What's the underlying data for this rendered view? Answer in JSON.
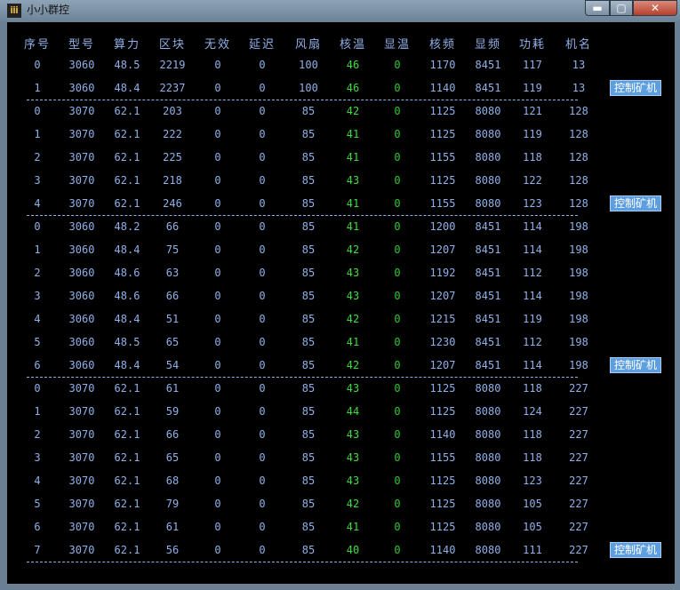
{
  "window": {
    "title": "小小群控",
    "icon": "app-logo-icon",
    "controls": {
      "minimize": "▬",
      "maximize": "▢",
      "close": "✕"
    }
  },
  "colors": {
    "background": "#000000",
    "text": "#8fb0e8",
    "core_temp": "#3ddc3d",
    "button": "#5d9ee0"
  },
  "table": {
    "columns": [
      "序号",
      "型号",
      "算力",
      "区块",
      "无效",
      "延迟",
      "风扇",
      "核温",
      "显温",
      "核频",
      "显频",
      "功耗",
      "机名"
    ],
    "groups": [
      {
        "button_label": "控制矿机",
        "rows": [
          [
            "0",
            "3060",
            "48.5",
            "2219",
            "0",
            "0",
            "100",
            "46",
            "0",
            "1170",
            "8451",
            "117",
            "13"
          ],
          [
            "1",
            "3060",
            "48.4",
            "2237",
            "0",
            "0",
            "100",
            "46",
            "0",
            "1140",
            "8451",
            "119",
            "13"
          ]
        ]
      },
      {
        "button_label": "控制矿机",
        "rows": [
          [
            "0",
            "3070",
            "62.1",
            "203",
            "0",
            "0",
            "85",
            "42",
            "0",
            "1125",
            "8080",
            "121",
            "128"
          ],
          [
            "1",
            "3070",
            "62.1",
            "222",
            "0",
            "0",
            "85",
            "41",
            "0",
            "1125",
            "8080",
            "119",
            "128"
          ],
          [
            "2",
            "3070",
            "62.1",
            "225",
            "0",
            "0",
            "85",
            "41",
            "0",
            "1155",
            "8080",
            "118",
            "128"
          ],
          [
            "3",
            "3070",
            "62.1",
            "218",
            "0",
            "0",
            "85",
            "43",
            "0",
            "1125",
            "8080",
            "122",
            "128"
          ],
          [
            "4",
            "3070",
            "62.1",
            "246",
            "0",
            "0",
            "85",
            "41",
            "0",
            "1155",
            "8080",
            "123",
            "128"
          ]
        ]
      },
      {
        "button_label": "控制矿机",
        "rows": [
          [
            "0",
            "3060",
            "48.2",
            "66",
            "0",
            "0",
            "85",
            "41",
            "0",
            "1200",
            "8451",
            "114",
            "198"
          ],
          [
            "1",
            "3060",
            "48.4",
            "75",
            "0",
            "0",
            "85",
            "42",
            "0",
            "1207",
            "8451",
            "114",
            "198"
          ],
          [
            "2",
            "3060",
            "48.6",
            "63",
            "0",
            "0",
            "85",
            "43",
            "0",
            "1192",
            "8451",
            "112",
            "198"
          ],
          [
            "3",
            "3060",
            "48.6",
            "66",
            "0",
            "0",
            "85",
            "43",
            "0",
            "1207",
            "8451",
            "114",
            "198"
          ],
          [
            "4",
            "3060",
            "48.4",
            "51",
            "0",
            "0",
            "85",
            "42",
            "0",
            "1215",
            "8451",
            "119",
            "198"
          ],
          [
            "5",
            "3060",
            "48.5",
            "65",
            "0",
            "0",
            "85",
            "41",
            "0",
            "1230",
            "8451",
            "112",
            "198"
          ],
          [
            "6",
            "3060",
            "48.4",
            "54",
            "0",
            "0",
            "85",
            "42",
            "0",
            "1207",
            "8451",
            "114",
            "198"
          ]
        ]
      },
      {
        "button_label": "控制矿机",
        "rows": [
          [
            "0",
            "3070",
            "62.1",
            "61",
            "0",
            "0",
            "85",
            "43",
            "0",
            "1125",
            "8080",
            "118",
            "227"
          ],
          [
            "1",
            "3070",
            "62.1",
            "59",
            "0",
            "0",
            "85",
            "44",
            "0",
            "1125",
            "8080",
            "124",
            "227"
          ],
          [
            "2",
            "3070",
            "62.1",
            "66",
            "0",
            "0",
            "85",
            "43",
            "0",
            "1140",
            "8080",
            "118",
            "227"
          ],
          [
            "3",
            "3070",
            "62.1",
            "65",
            "0",
            "0",
            "85",
            "43",
            "0",
            "1155",
            "8080",
            "118",
            "227"
          ],
          [
            "4",
            "3070",
            "62.1",
            "68",
            "0",
            "0",
            "85",
            "43",
            "0",
            "1125",
            "8080",
            "123",
            "227"
          ],
          [
            "5",
            "3070",
            "62.1",
            "79",
            "0",
            "0",
            "85",
            "42",
            "0",
            "1125",
            "8080",
            "105",
            "227"
          ],
          [
            "6",
            "3070",
            "62.1",
            "61",
            "0",
            "0",
            "85",
            "41",
            "0",
            "1125",
            "8080",
            "105",
            "227"
          ],
          [
            "7",
            "3070",
            "62.1",
            "56",
            "0",
            "0",
            "85",
            "40",
            "0",
            "1140",
            "8080",
            "111",
            "227"
          ]
        ]
      }
    ]
  }
}
